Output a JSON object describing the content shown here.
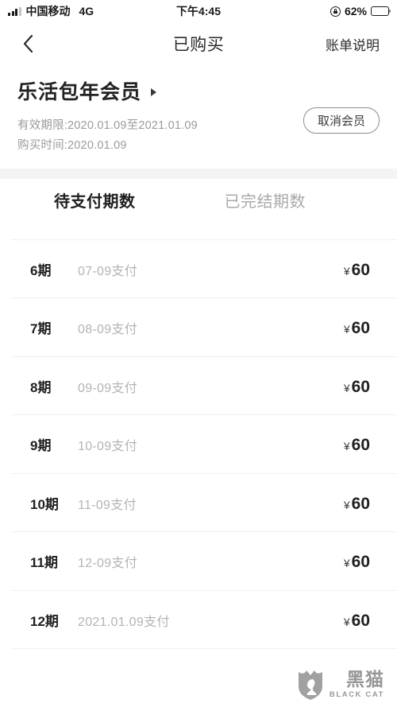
{
  "status_bar": {
    "carrier": "中国移动",
    "network": "4G",
    "time": "下午4:45",
    "battery_percent": "62%",
    "signal_icon": "signal-bars-icon",
    "rotation_lock_icon": "rotation-lock-icon",
    "battery_icon": "battery-icon"
  },
  "nav": {
    "back_icon": "back-chevron-icon",
    "title": "已购买",
    "action_label": "账单说明"
  },
  "product": {
    "title": "乐活包年会员",
    "title_arrow_icon": "chevron-right-icon",
    "valid_period": "有效期限:2020.01.09至2021.01.09",
    "purchase_time": "购买时间:2020.01.09",
    "cancel_label": "取消会员"
  },
  "tabs": [
    {
      "label": "待支付期数",
      "active": true
    },
    {
      "label": "已完结期数",
      "active": false
    }
  ],
  "installments": [
    {
      "period": "",
      "date": "",
      "currency": "",
      "amount": "",
      "clipped": true
    },
    {
      "period": "6期",
      "date": "07-09支付",
      "currency": "¥",
      "amount": "60"
    },
    {
      "period": "7期",
      "date": "08-09支付",
      "currency": "¥",
      "amount": "60"
    },
    {
      "period": "8期",
      "date": "09-09支付",
      "currency": "¥",
      "amount": "60"
    },
    {
      "period": "9期",
      "date": "10-09支付",
      "currency": "¥",
      "amount": "60"
    },
    {
      "period": "10期",
      "date": "11-09支付",
      "currency": "¥",
      "amount": "60"
    },
    {
      "period": "11期",
      "date": "12-09支付",
      "currency": "¥",
      "amount": "60"
    },
    {
      "period": "12期",
      "date": "2021.01.09支付",
      "currency": "¥",
      "amount": "60"
    }
  ],
  "watermark": {
    "cn": "黑猫",
    "en": "BLACK CAT",
    "icon": "black-cat-shield-icon",
    "color": "#8f8f8f"
  },
  "colors": {
    "background": "#ffffff",
    "section_gap": "#f4f4f6",
    "text_primary": "#1f1f1f",
    "text_muted": "#b4b4b4",
    "divider": "#f0f0f0"
  }
}
